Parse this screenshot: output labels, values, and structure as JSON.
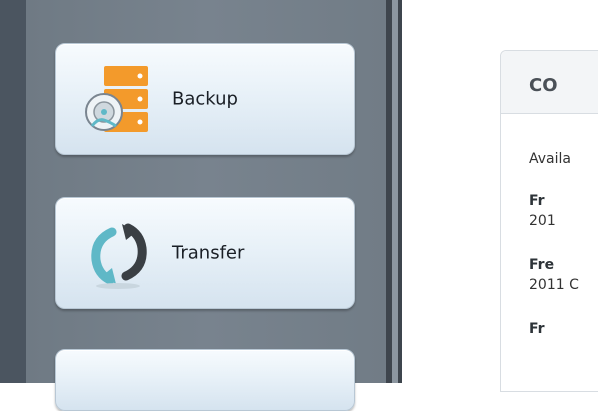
{
  "sidebar": {
    "items": [
      {
        "label": "Backup",
        "icon": "backup-server-disk-icon"
      },
      {
        "label": "Transfer",
        "icon": "transfer-arrows-icon"
      },
      {
        "label": "",
        "icon": ""
      }
    ]
  },
  "main": {
    "card_title": "CO",
    "available_label": "Availa",
    "entries": [
      {
        "name": "Fr",
        "detail": "201"
      },
      {
        "name": "Fre",
        "detail": "2011 C"
      },
      {
        "name": "Fr",
        "detail": ""
      }
    ]
  },
  "colors": {
    "sidebar_bg": "#75808a",
    "button_bg": "#e8f1f8",
    "accent_orange": "#f39a2b",
    "accent_teal": "#5fb8c7",
    "icon_dark": "#3a3f44"
  }
}
